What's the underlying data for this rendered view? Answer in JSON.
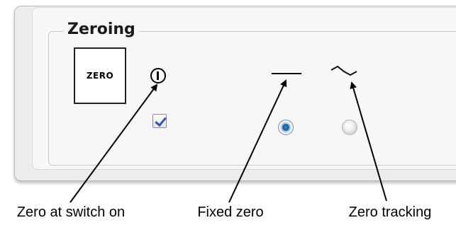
{
  "zeroing": {
    "group_title": "Zeroing",
    "zero_button_label": "ZERO",
    "zero_at_switch_on": {
      "icon": "power-icon",
      "checked": true
    },
    "fixed_zero": {
      "icon": "horizontal-line-icon",
      "selected": true
    },
    "zero_tracking": {
      "icon": "wave-line-icon",
      "selected": false
    }
  },
  "callouts": {
    "zero_at_switch_on": "Zero at switch on",
    "fixed_zero": "Fixed zero",
    "zero_tracking": "Zero tracking"
  },
  "colors": {
    "panel_bg": "#ececec",
    "checkmark": "#2b55b8",
    "radio_selected": "#1a5e9e"
  }
}
